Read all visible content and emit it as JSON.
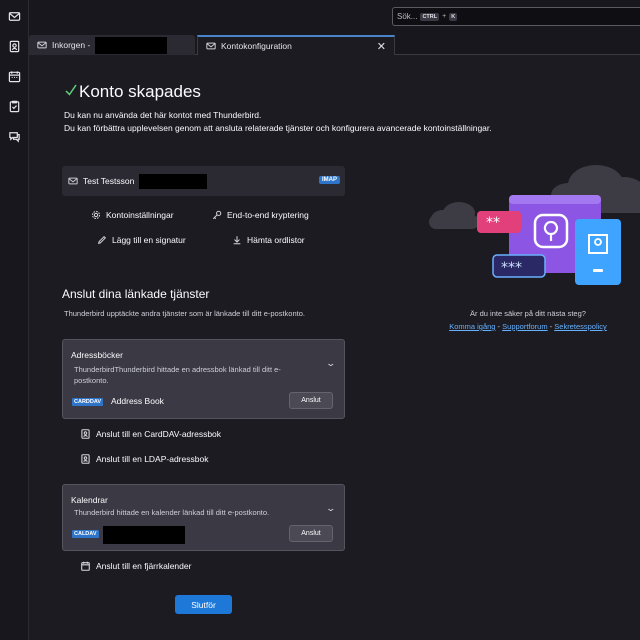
{
  "toolbar": {
    "search_placeholder": "Sök...",
    "shortcut_mod": "CTRL",
    "shortcut_plus": "+",
    "shortcut_key": "K"
  },
  "tabs": [
    {
      "label": "Inkorgen -",
      "icon": "mail-icon"
    },
    {
      "label": "Kontokonfiguration",
      "icon": "mail-settings-icon",
      "close": "✕"
    }
  ],
  "header": {
    "title": "Konto skapades",
    "line1": "Du kan nu använda det här kontot med Thunderbird.",
    "line2": "Du kan förbättra upplevelsen genom att ansluta relaterade tjänster och konfigurera avancerade kontoinställningar."
  },
  "account": {
    "name": "Test Testsson",
    "protocol": "IMAP"
  },
  "actions": {
    "settings": "Kontoinställningar",
    "e2e": "End-to-end kryptering",
    "signature": "Lägg till en signatur",
    "dictionaries": "Hämta ordlistor"
  },
  "linked": {
    "heading": "Anslut dina länkade tjänster",
    "description": "Thunderbird upptäckte andra tjänster som är länkade till ditt e-postkonto."
  },
  "addressbooks": {
    "title": "Adressböcker",
    "desc1": "ThunderbirdThunderbird hittade en adressbok länkad till ditt e-",
    "desc2": "postkonto.",
    "badge": "CARDDAV",
    "item": "Address Book",
    "connect": "Anslut",
    "chevron": "⌄"
  },
  "ab_links": {
    "carddav": "Anslut till en CardDAV-adressbok",
    "ldap": "Anslut till en LDAP-adressbok"
  },
  "calendars": {
    "title": "Kalendrar",
    "desc": "Thunderbird hittade en kalender länkad till ditt e-postkonto.",
    "badge": "CALDAV",
    "connect": "Anslut",
    "chevron": "⌄"
  },
  "cal_link": "Anslut till en fjärrkalender",
  "finish": "Slutför",
  "help": {
    "question": "Är du inte säker på ditt nästa steg?",
    "link1": "Komma igång",
    "sep1": " - ",
    "link2": "Supportforum",
    "sep2": " - ",
    "link3": "Sekretesspolicy"
  },
  "colors": {
    "background": "#1c1b22",
    "accent": "#1d78d8",
    "success": "#5fd27c",
    "badge": "#2e74c8",
    "link": "#65b1ff"
  }
}
